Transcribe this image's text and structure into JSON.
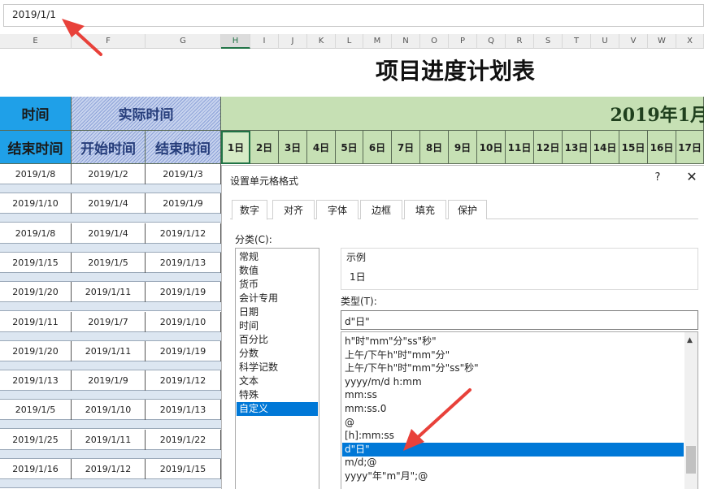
{
  "formula_bar": {
    "value": "2019/1/1"
  },
  "columns": [
    "E",
    "F",
    "G",
    "H",
    "I",
    "J",
    "K",
    "L",
    "M",
    "N",
    "O",
    "P",
    "Q",
    "R",
    "S",
    "T",
    "U",
    "V",
    "W",
    "X"
  ],
  "selected_column": "H",
  "sheet": {
    "title": "项目进度计划表",
    "planned_header": "时间",
    "actual_header": "实际时间",
    "col_end": "结束时间",
    "col_actual_start": "开始时间",
    "col_actual_end": "结束时间",
    "month_header": "2019年1月",
    "days": [
      "1日",
      "2日",
      "3日",
      "4日",
      "5日",
      "6日",
      "7日",
      "8日",
      "9日",
      "10日",
      "11日",
      "12日",
      "13日",
      "14日",
      "15日",
      "16日",
      "17日"
    ],
    "rows": [
      [
        "2019/1/8",
        "2019/1/2",
        "2019/1/3"
      ],
      [
        "2019/1/10",
        "2019/1/4",
        "2019/1/9"
      ],
      [
        "2019/1/8",
        "2019/1/4",
        "2019/1/12"
      ],
      [
        "2019/1/15",
        "2019/1/5",
        "2019/1/13"
      ],
      [
        "2019/1/20",
        "2019/1/11",
        "2019/1/19"
      ],
      [
        "2019/1/11",
        "2019/1/7",
        "2019/1/10"
      ],
      [
        "2019/1/20",
        "2019/1/11",
        "2019/1/19"
      ],
      [
        "2019/1/13",
        "2019/1/9",
        "2019/1/12"
      ],
      [
        "2019/1/5",
        "2019/1/10",
        "2019/1/13"
      ],
      [
        "2019/1/25",
        "2019/1/11",
        "2019/1/22"
      ],
      [
        "2019/1/16",
        "2019/1/12",
        "2019/1/15"
      ]
    ]
  },
  "dialog": {
    "title": "设置单元格格式",
    "help": "?",
    "close": "✕",
    "tabs": [
      "数字",
      "对齐",
      "字体",
      "边框",
      "填充",
      "保护"
    ],
    "active_tab": 0,
    "category_label": "分类(C):",
    "categories": [
      "常规",
      "数值",
      "货币",
      "会计专用",
      "日期",
      "时间",
      "百分比",
      "分数",
      "科学记数",
      "文本",
      "特殊",
      "自定义"
    ],
    "selected_category": 11,
    "sample_label": "示例",
    "sample_value": "1日",
    "type_label": "类型(T):",
    "type_value": "d\"日\"",
    "formats": [
      "h\"时\"mm\"分\"ss\"秒\"",
      "上午/下午h\"时\"mm\"分\"",
      "上午/下午h\"时\"mm\"分\"ss\"秒\"",
      "yyyy/m/d h:mm",
      "mm:ss",
      "mm:ss.0",
      "@",
      "[h]:mm:ss",
      "d\"日\"",
      "m/d;@",
      "yyyy\"年\"m\"月\";@"
    ],
    "selected_format": 8
  },
  "colors": {
    "accent": "#0078d7",
    "header_blue": "#1fa0e8",
    "header_green": "#c6e0b4",
    "arrow_red": "#e8413a"
  }
}
